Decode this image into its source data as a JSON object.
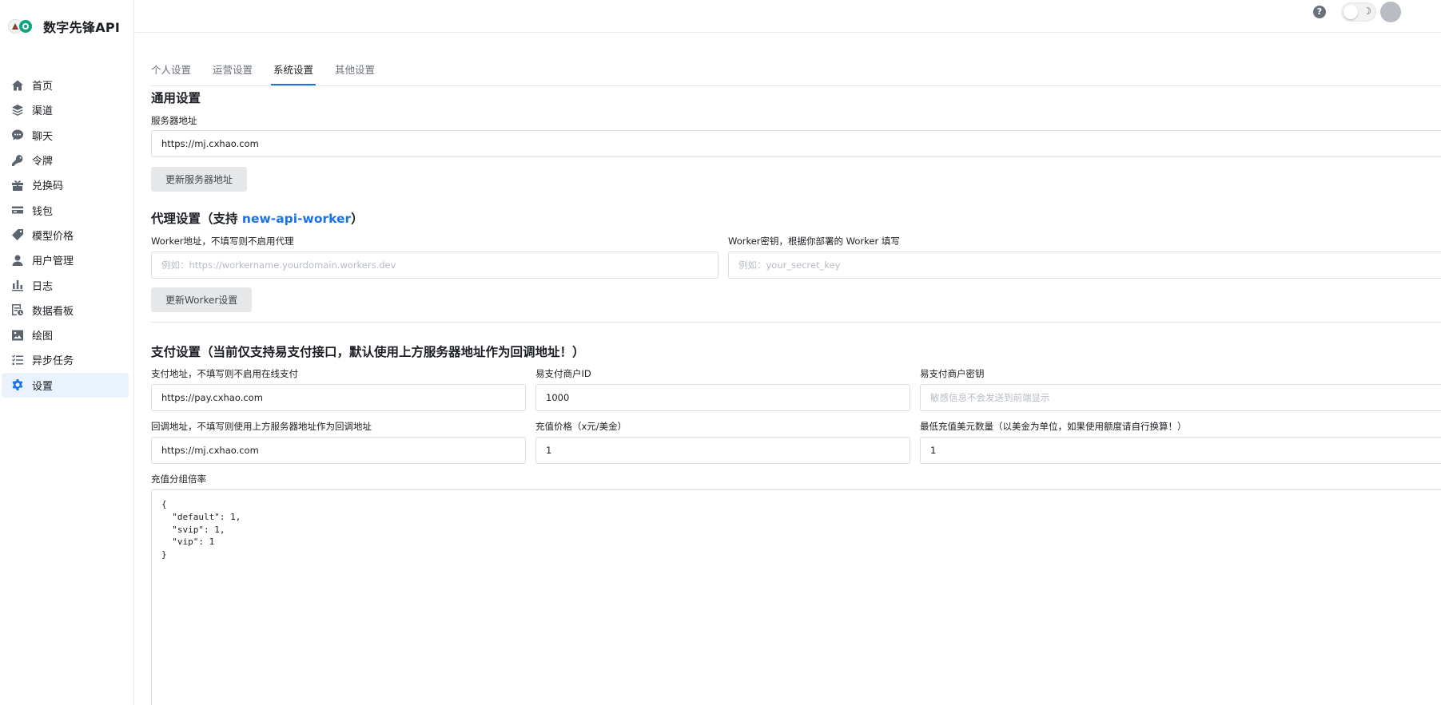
{
  "brand": {
    "name": "数字先锋API"
  },
  "sidebar": {
    "items": [
      {
        "label": "首页",
        "icon": "home-icon"
      },
      {
        "label": "渠道",
        "icon": "layers-icon"
      },
      {
        "label": "聊天",
        "icon": "chat-icon"
      },
      {
        "label": "令牌",
        "icon": "key-icon"
      },
      {
        "label": "兑换码",
        "icon": "gift-icon"
      },
      {
        "label": "钱包",
        "icon": "credit-card-icon"
      },
      {
        "label": "模型价格",
        "icon": "price-tag-icon"
      },
      {
        "label": "用户管理",
        "icon": "user-icon"
      },
      {
        "label": "日志",
        "icon": "bar-chart-icon"
      },
      {
        "label": "数据看板",
        "icon": "dashboard-icon"
      },
      {
        "label": "绘图",
        "icon": "image-icon"
      },
      {
        "label": "异步任务",
        "icon": "task-list-icon"
      },
      {
        "label": "设置",
        "icon": "gear-icon",
        "active": true
      }
    ]
  },
  "header": {
    "help_glyph": "?",
    "theme_glyph": "☽"
  },
  "tabs": [
    {
      "label": "个人设置"
    },
    {
      "label": "运营设置"
    },
    {
      "label": "系统设置",
      "active": true
    },
    {
      "label": "其他设置"
    }
  ],
  "general": {
    "title": "通用设置",
    "server_label": "服务器地址",
    "server_value": "https://mj.cxhao.com",
    "update_button": "更新服务器地址"
  },
  "proxy": {
    "title_prefix": "代理设置（支持 ",
    "title_link": "new-api-worker",
    "title_suffix": "）",
    "worker_url_label": "Worker地址，不填写则不启用代理",
    "worker_url_placeholder": "例如：https://workername.yourdomain.workers.dev",
    "worker_key_label": "Worker密钥，根据你部署的 Worker 填写",
    "worker_key_placeholder": "例如：your_secret_key",
    "update_button": "更新Worker设置"
  },
  "payment": {
    "title": "支付设置（当前仅支持易支付接口，默认使用上方服务器地址作为回调地址！）",
    "pay_address_label": "支付地址，不填写则不启用在线支付",
    "pay_address_value": "https://pay.cxhao.com",
    "merchant_id_label": "易支付商户ID",
    "merchant_id_value": "1000",
    "merchant_key_label": "易支付商户密钥",
    "merchant_key_placeholder": "敏感信息不会发送到前端显示",
    "callback_label": "回调地址，不填写则使用上方服务器地址作为回调地址",
    "callback_value": "https://mj.cxhao.com",
    "price_label": "充值价格（x元/美金）",
    "price_value": "1",
    "min_amount_label": "最低充值美元数量（以美金为单位，如果使用额度请自行换算！）",
    "min_amount_value": "1",
    "group_ratio_label": "充值分组倍率",
    "group_ratio_value": "{\n  \"default\": 1,\n  \"svip\": 1,\n  \"vip\": 1\n}"
  },
  "colors": {
    "accent": "#1a73e8",
    "active_bg": "#eaf3fd",
    "button_bg": "#e6e7e9"
  }
}
